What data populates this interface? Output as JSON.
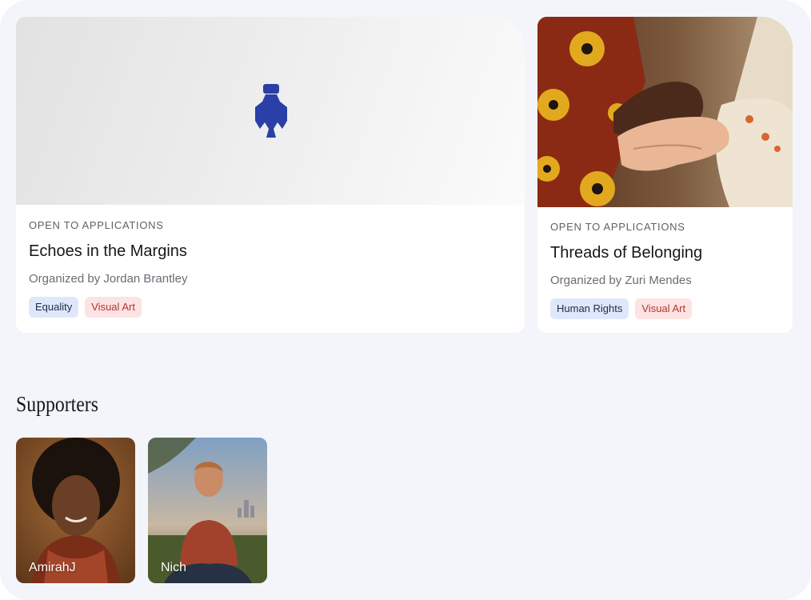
{
  "cards": [
    {
      "status": "OPEN TO APPLICATIONS",
      "title": "Echoes in the Margins",
      "organizer": "Organized by Jordan Brantley",
      "tags": [
        "Equality",
        "Visual Art"
      ],
      "media_icon": "bird-logo-icon",
      "logo_color": "#2a40a6"
    },
    {
      "status": "OPEN TO APPLICATIONS",
      "title": "Threads of Belonging",
      "organizer": "Organized by Zuri Mendes",
      "tags": [
        "Human Rights",
        "Visual Art"
      ],
      "media_icon": "holding-hands-photo"
    }
  ],
  "supporters_section": {
    "title": "Supporters",
    "people": [
      {
        "name": "AmirahJ"
      },
      {
        "name": "Nich"
      }
    ]
  },
  "colors": {
    "tag_blue_bg": "#dfe8fb",
    "tag_red_bg": "#fde3e3",
    "tag_red_text": "#b4352b",
    "page_bg": "#f4f5fa"
  }
}
